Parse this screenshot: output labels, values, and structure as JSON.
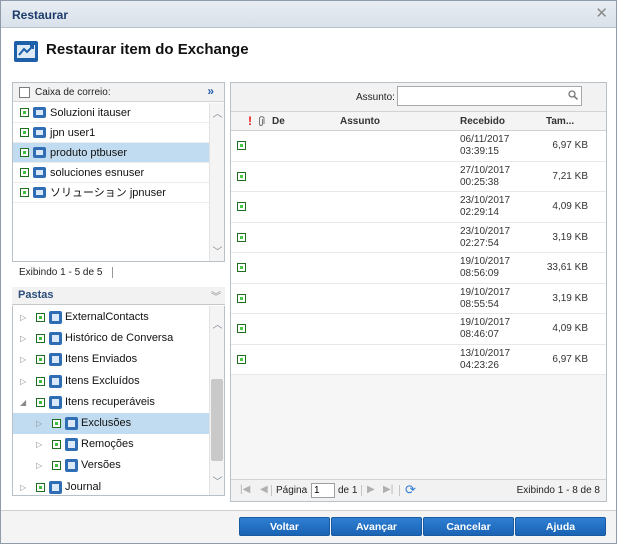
{
  "window": {
    "title": "Restaurar",
    "close_glyph": "✕"
  },
  "header": {
    "icon": "restore-exchange-icon",
    "title": "Restaurar item do Exchange"
  },
  "mailbox": {
    "header_label": "Caixa de correio:",
    "more_glyph": "»",
    "items": [
      {
        "name": "Soluzioni itauser",
        "selected": false
      },
      {
        "name": "jpn user1",
        "selected": false
      },
      {
        "name": "produto ptbuser",
        "selected": true
      },
      {
        "name": "soluciones esnuser",
        "selected": false
      },
      {
        "name": "ソリューション jpnuser",
        "selected": false
      }
    ],
    "footer": "Exibindo 1 - 5 de 5"
  },
  "folders": {
    "header_label": "Pastas",
    "items": [
      {
        "name": "ExternalContacts",
        "level": 0,
        "expand": "▷",
        "selected": false
      },
      {
        "name": "Histórico de Conversa",
        "level": 0,
        "expand": "▷",
        "selected": false
      },
      {
        "name": "Itens Enviados",
        "level": 0,
        "expand": "▷",
        "selected": false
      },
      {
        "name": "Itens Excluídos",
        "level": 0,
        "expand": "▷",
        "selected": false
      },
      {
        "name": "Itens recuperáveis",
        "level": 0,
        "expand": "◢",
        "selected": false
      },
      {
        "name": "Exclusões",
        "level": 1,
        "expand": "▷",
        "selected": true
      },
      {
        "name": "Remoções",
        "level": 1,
        "expand": "▷",
        "selected": false
      },
      {
        "name": "Versões",
        "level": 1,
        "expand": "▷",
        "selected": false
      },
      {
        "name": "Journal",
        "level": 0,
        "expand": "▷",
        "selected": false
      }
    ]
  },
  "search": {
    "label": "Assunto:",
    "value": "",
    "placeholder": ""
  },
  "grid": {
    "columns": {
      "importance": "!",
      "attachment": "📎",
      "from": "De",
      "subject": "Assunto",
      "received": "Recebido",
      "size": "Tam..."
    },
    "rows": [
      {
        "received": "06/11/2017\n03:39:15",
        "size": "6,97 KB"
      },
      {
        "received": "27/10/2017\n00:25:38",
        "size": "7,21 KB"
      },
      {
        "received": "23/10/2017\n02:29:14",
        "size": "4,09 KB"
      },
      {
        "received": "23/10/2017\n02:27:54",
        "size": "3,19 KB"
      },
      {
        "received": "19/10/2017\n08:56:09",
        "size": "33,61 KB"
      },
      {
        "received": "19/10/2017\n08:55:54",
        "size": "3,19 KB"
      },
      {
        "received": "19/10/2017\n08:46:07",
        "size": "4,09 KB"
      },
      {
        "received": "13/10/2017\n04:23:26",
        "size": "6,97 KB"
      }
    ]
  },
  "pager": {
    "page_label": "Página",
    "page_value": "1",
    "of_label": "de 1",
    "info": "Exibindo 1 - 8 de 8"
  },
  "buttons": {
    "back": "Voltar",
    "next": "Avançar",
    "cancel": "Cancelar",
    "help": "Ajuda"
  },
  "colors": {
    "accent": "#1a63b4",
    "selection": "#c1dcf0",
    "title_text": "#1b3c6b"
  }
}
